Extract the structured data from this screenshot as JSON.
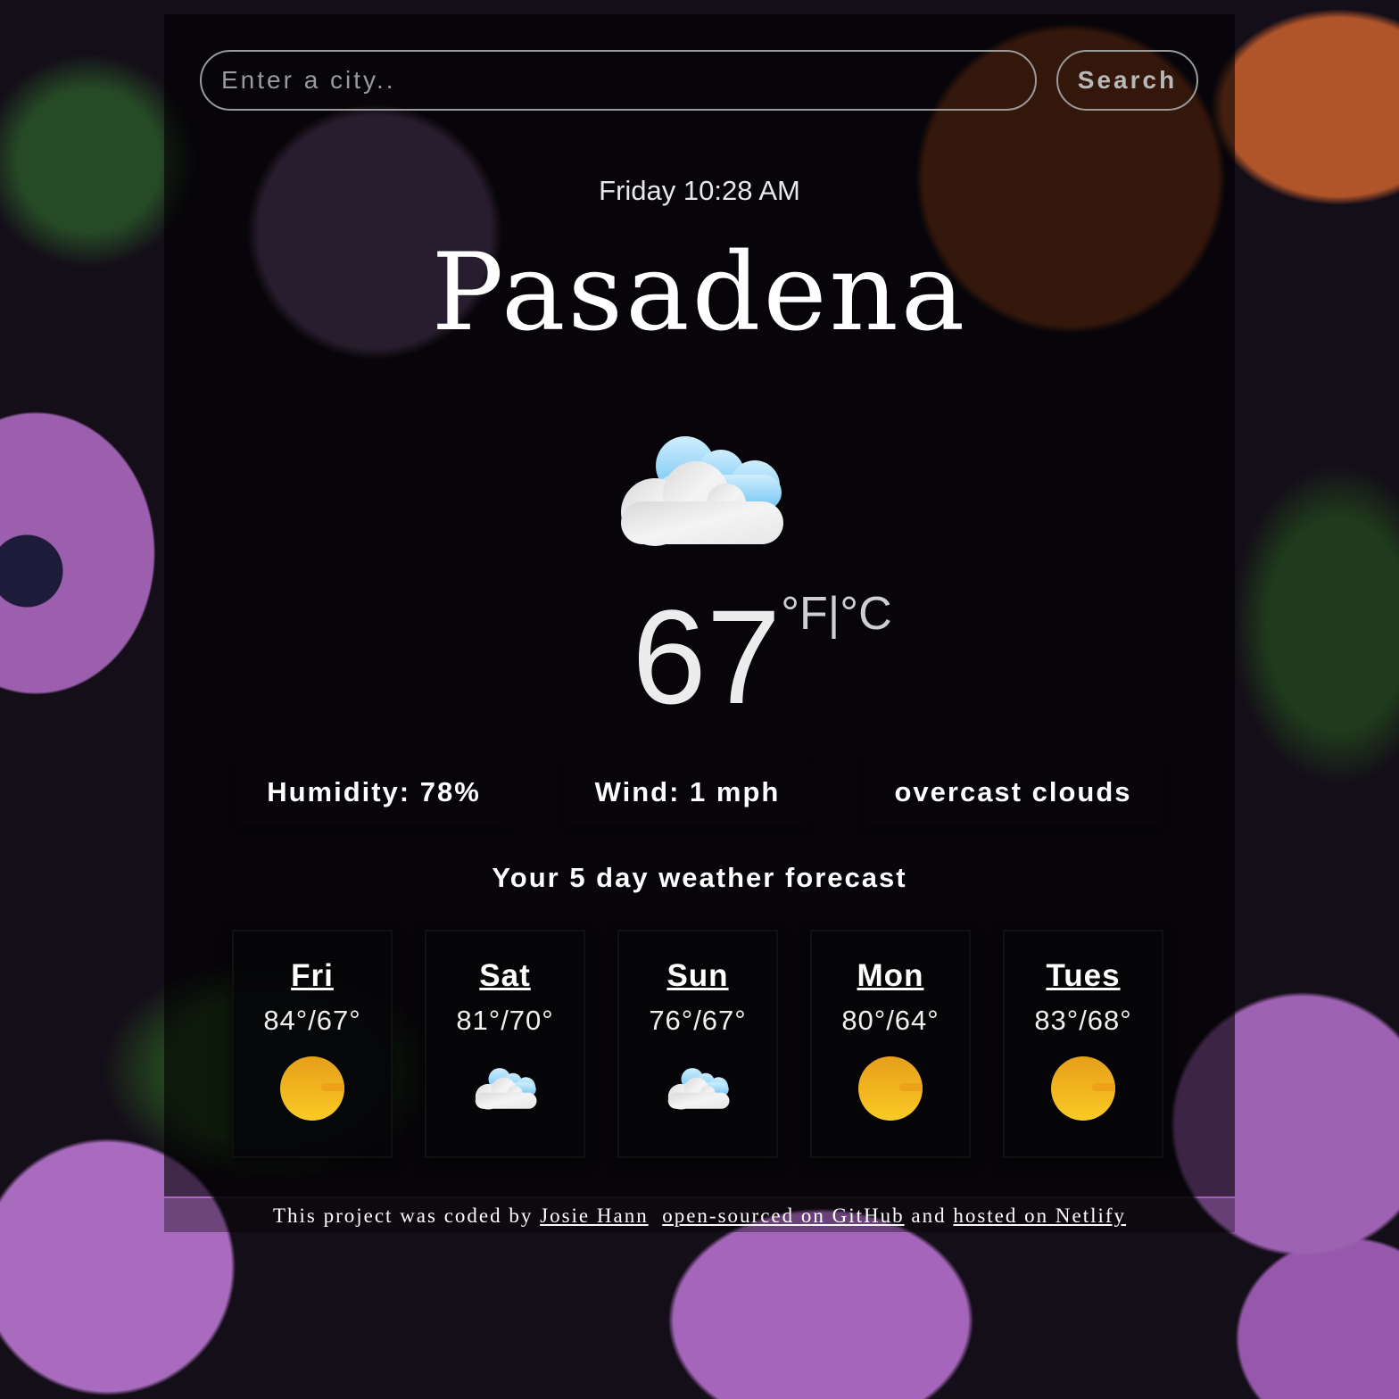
{
  "search": {
    "placeholder": "Enter a city..",
    "value": "",
    "button_label": "Search"
  },
  "current": {
    "datetime": "Friday 10:28 AM",
    "city": "Pasadena",
    "icon": "cloud-icon",
    "temperature": "67",
    "unit_f": "°F",
    "unit_separator": "|",
    "unit_c": "°C",
    "humidity": "Humidity: 78%",
    "wind": "Wind: 1 mph",
    "description": "overcast clouds"
  },
  "forecast": {
    "title": "Your 5 day weather forecast",
    "days": [
      {
        "day": "Fri",
        "temps": "84°/67°",
        "icon": "sun-icon"
      },
      {
        "day": "Sat",
        "temps": "81°/70°",
        "icon": "cloud-icon"
      },
      {
        "day": "Sun",
        "temps": "76°/67°",
        "icon": "cloud-icon"
      },
      {
        "day": "Mon",
        "temps": "80°/64°",
        "icon": "sun-icon"
      },
      {
        "day": "Tues",
        "temps": "83°/68°",
        "icon": "sun-icon"
      }
    ]
  },
  "footer": {
    "prefix": "This project was coded by ",
    "author_link": "Josie Hann",
    "github_link": "open-sourced on GitHub",
    "middle": " and ",
    "netlify_link": "hosted on Netlify"
  }
}
